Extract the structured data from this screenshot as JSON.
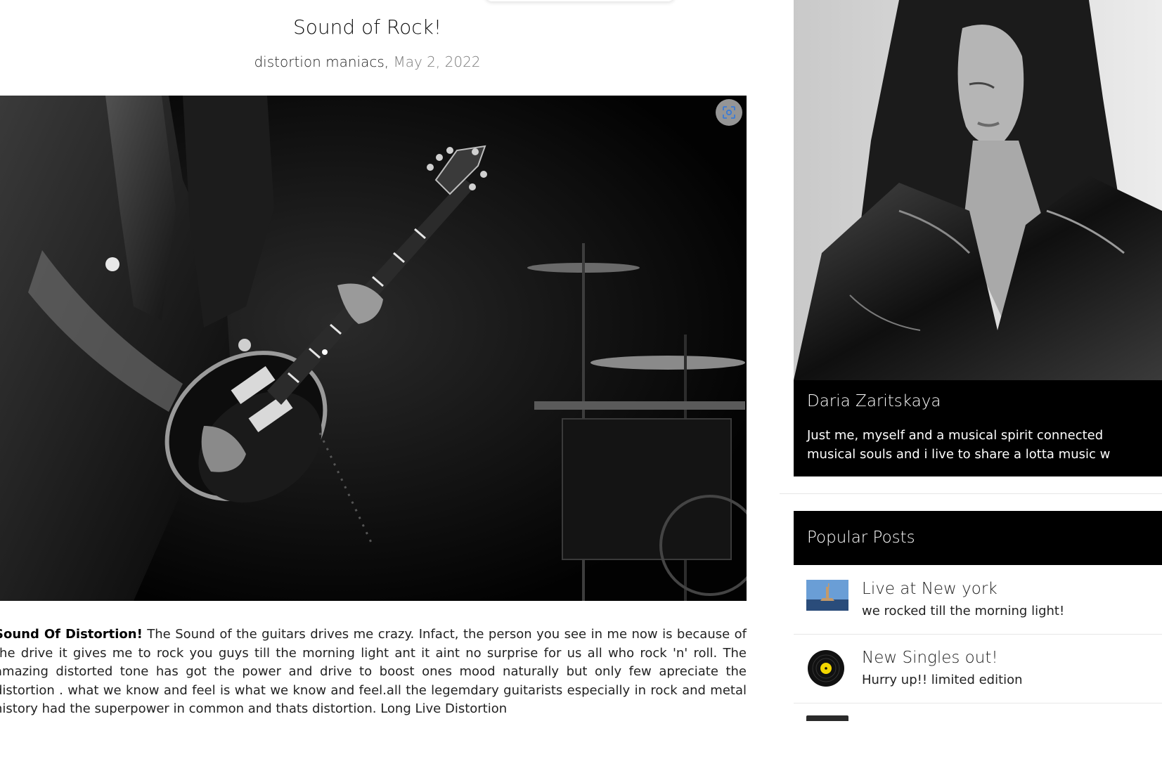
{
  "post": {
    "title": "Sound of Rock!",
    "author": "distortion maniacs,",
    "date": "May 2, 2022",
    "body_lead": "Sound Of Distortion!",
    "body_text": " The Sound of the guitars drives me crazy. Infact, the person you see in me now is because of the drive it gives me to rock you guys till the morning light ant it aint no surprise for us all who rock 'n' roll. The amazing distorted tone has got the power and drive to boost ones mood naturally but only few apreciate the distortion . what we know and feel is what we know and feel.all the legemdary guitarists especially in rock and metal history had the superpower in common and thats distortion. Long Live Distortion",
    "lens_icon": "visual-search-icon"
  },
  "profile": {
    "name": "Daria Zaritskaya",
    "bio_line1": "Just me, myself and a musical spirit connected",
    "bio_line2": "musical souls and i live to share a lotta music w"
  },
  "popular": {
    "title": "Popular Posts",
    "items": [
      {
        "title": "Live at New york",
        "subtitle": "we rocked till the morning light!",
        "thumb": "statue-of-liberty-thumbnail"
      },
      {
        "title": "New Singles out!",
        "subtitle": "Hurry up!! limited edition",
        "thumb": "vinyl-record-icon"
      }
    ]
  },
  "colors": {
    "accent_bar": "#000000",
    "vinyl_label": "#f2d600",
    "lens_icon": "#3b7bd6"
  }
}
